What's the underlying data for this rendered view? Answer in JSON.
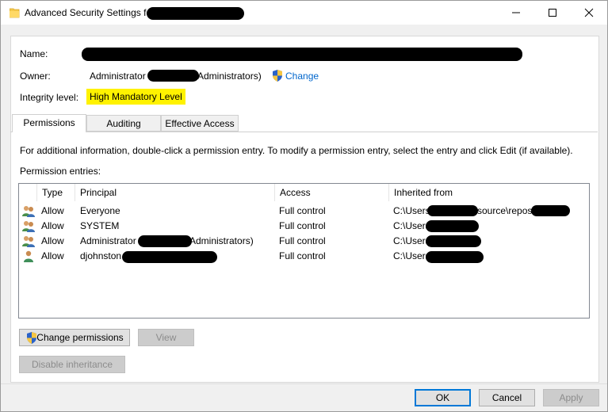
{
  "window": {
    "title": "Advanced Security Settings fo",
    "controls": {
      "minimize": "—",
      "maximize": "☐",
      "close": "✕"
    }
  },
  "header": {
    "name_label": "Name:",
    "owner_label": "Owner:",
    "owner_value_prefix": "Administrator",
    "owner_value_suffix": "Administrators)",
    "change_link": "Change",
    "integrity_label": "Integrity level:",
    "integrity_value": "High Mandatory Level"
  },
  "tabs": [
    {
      "label": "Permissions",
      "active": true
    },
    {
      "label": "Auditing",
      "active": false
    },
    {
      "label": "Effective Access",
      "active": false
    }
  ],
  "info_text": "For additional information, double-click a permission entry. To modify a permission entry, select the entry and click Edit (if available).",
  "entries_label": "Permission entries:",
  "table": {
    "columns": [
      "Type",
      "Principal",
      "Access",
      "Inherited from"
    ],
    "rows": [
      {
        "type": "Allow",
        "principal": "Everyone",
        "access": "Full control",
        "inherited_prefix": "C:\\Users",
        "inherited_mid": "source\\repos",
        "icon": "group-users-icon"
      },
      {
        "type": "Allow",
        "principal": "SYSTEM",
        "access": "Full control",
        "inherited_prefix": "C:\\Users",
        "icon": "group-users-icon"
      },
      {
        "type": "Allow",
        "principal": "Administrator",
        "principal_suffix": "Administrators)",
        "access": "Full control",
        "inherited_prefix": "C:\\Users",
        "icon": "group-users-icon"
      },
      {
        "type": "Allow",
        "principal": "djohnston",
        "access": "Full control",
        "inherited_prefix": "C:\\Users",
        "icon": "single-user-icon"
      }
    ]
  },
  "buttons": {
    "change_permissions": "Change permissions",
    "view": "View",
    "disable_inheritance": "Disable inheritance",
    "ok": "OK",
    "cancel": "Cancel",
    "apply": "Apply"
  },
  "colors": {
    "highlight": "#fff200",
    "link": "#0066cc",
    "accent": "#0078d7"
  }
}
